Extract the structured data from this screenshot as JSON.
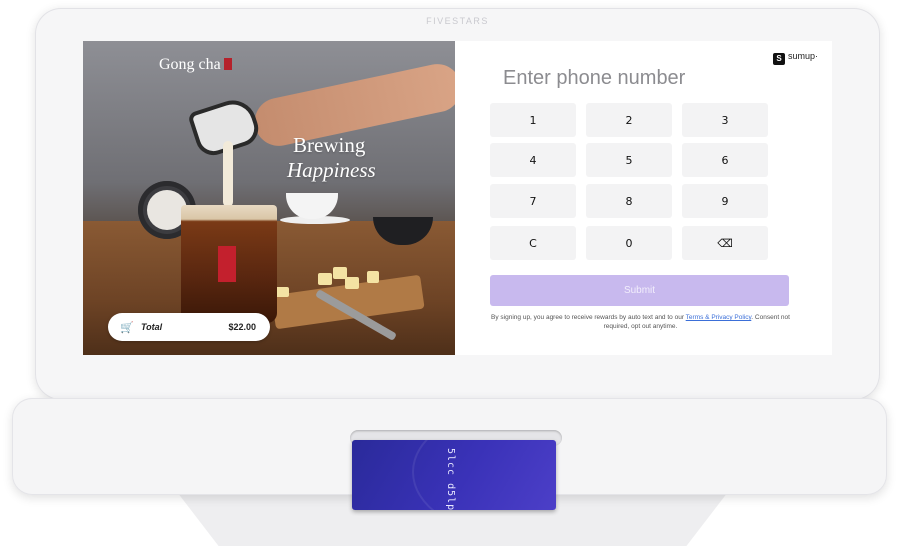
{
  "device": {
    "brand": "FIVESTARS"
  },
  "promo": {
    "logo": "Gong cha",
    "headline_line1": "Brewing",
    "headline_line2": "Happiness",
    "total_label": "Total",
    "total_amount": "$22.00"
  },
  "sumup": {
    "mark": "S",
    "label": "sumup·"
  },
  "keypad": {
    "prompt": "Enter phone number",
    "keys": [
      "1",
      "2",
      "3",
      "4",
      "5",
      "6",
      "7",
      "8",
      "9",
      "C",
      "0",
      "⌫"
    ],
    "submit_label": "Submit",
    "consent_prefix": "By signing up, you agree to receive rewards by auto text and to our ",
    "consent_link": "Terms & Privacy Policy",
    "consent_suffix": ". Consent not required, opt out anytime."
  },
  "card": {
    "text": "5lcc d5lp 5lcc"
  },
  "colors": {
    "submit": "#c8b9ee",
    "card": "#3a32b8",
    "accent_link": "#3b6fd8"
  }
}
